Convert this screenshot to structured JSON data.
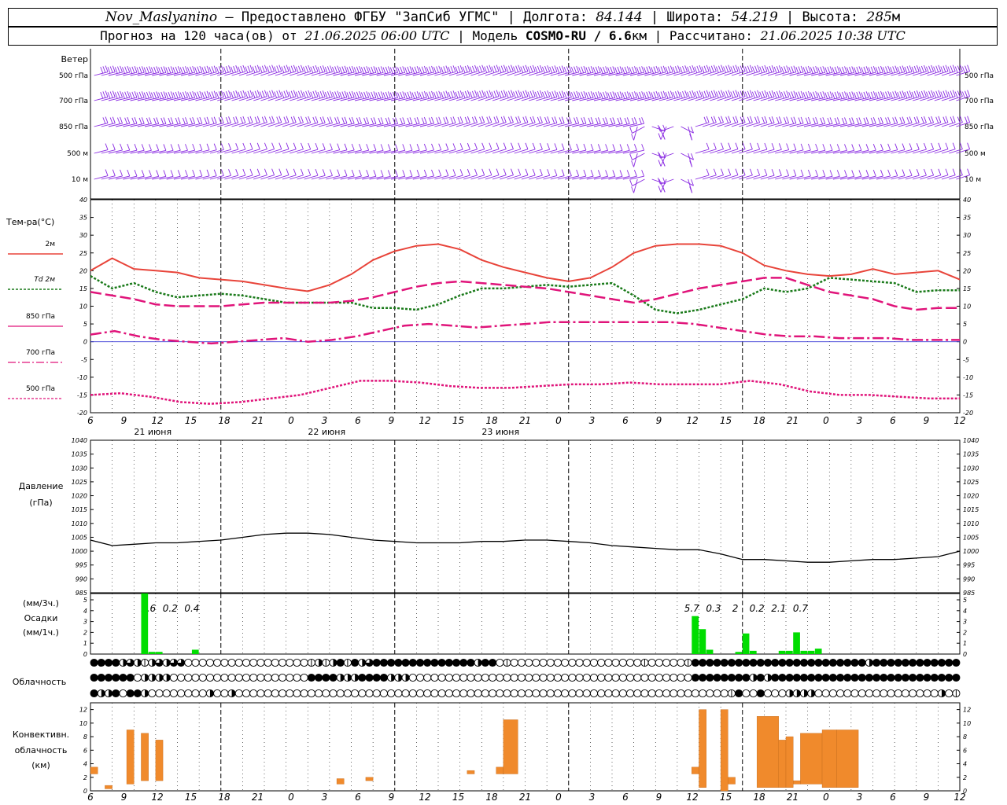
{
  "header": {
    "station": "Nov_Maslyanino",
    "provider": "— Предоставлено ФГБУ \"ЗапСиб УГМС\"",
    "lon_label": "Долгота:",
    "lon": "84.144",
    "lat_label": "Широта:",
    "lat": "54.219",
    "alt_label": "Высота:",
    "alt": "285",
    "alt_unit": "м",
    "forecast_label": "Прогноз на 120 часа(ов) от",
    "forecast_time": "21.06.2025 06:00 UTC",
    "model_label": "Модель",
    "model": "COSMO-RU / 6.6",
    "model_unit": "км",
    "calc_label": "Рассчитано:",
    "calc_time": "21.06.2025 10:38 UTC"
  },
  "colors": {
    "wind": "#8a2be2",
    "t2m": "#e8443a",
    "td2m": "#1a7a1a",
    "t850": "#e0147a",
    "t700": "#e0147a",
    "t500": "#e0147a",
    "zero_line": "#3b3bd6",
    "pressure": "#000000",
    "precip": "#00dd00",
    "convective": "#f08a2c"
  },
  "wind_panel": {
    "title": "Ветер",
    "levels": [
      "500 гПа",
      "700 гПа",
      "850 гПа",
      "500 м",
      "10 м"
    ]
  },
  "temp_panel": {
    "title": "Тем-ра(°С)",
    "legend": [
      "2м",
      "Td 2м",
      "850 гПа",
      "700 гПа",
      "500 гПа"
    ],
    "yticks": [
      40,
      35,
      30,
      25,
      20,
      15,
      10,
      5,
      0,
      -5,
      -10,
      -15,
      -20
    ]
  },
  "time_axis": {
    "hour_labels": [
      "6",
      "9",
      "12",
      "15",
      "18",
      "21",
      "0",
      "3",
      "6",
      "9",
      "12",
      "15",
      "18",
      "21",
      "0",
      "3",
      "6",
      "9",
      "12",
      "15",
      "18",
      "21",
      "0",
      "3",
      "6",
      "9",
      "12"
    ],
    "day_labels": [
      "21 июня",
      "22 июня",
      "23 июня"
    ]
  },
  "pressure_panel": {
    "title": "Давление",
    "unit": "(гПа)",
    "yticks": [
      1040,
      1035,
      1030,
      1025,
      1020,
      1015,
      1010,
      1005,
      1000,
      995,
      990,
      985
    ]
  },
  "precip_panel": {
    "unit3": "(мм/3ч.)",
    "title": "Осадки",
    "unit1": "(мм/1ч.)",
    "yticks": [
      5,
      4,
      3,
      2,
      1,
      0
    ],
    "sums": [
      {
        "h": 8,
        "text": "5.6"
      },
      {
        "h": 11,
        "text": "0.2"
      },
      {
        "h": 14,
        "text": "0.4"
      },
      {
        "h": 83,
        "text": "5.7"
      },
      {
        "h": 86,
        "text": "0.3"
      },
      {
        "h": 89,
        "text": "2"
      },
      {
        "h": 92,
        "text": "0.2"
      },
      {
        "h": 95,
        "text": "2.1"
      },
      {
        "h": 98,
        "text": "0.7"
      }
    ]
  },
  "cloud_panel": {
    "title": "Облачность"
  },
  "conv_panel": {
    "title1": "Конвективн.",
    "title2": "облачность",
    "unit": "(км)",
    "yticks": [
      12,
      10,
      8,
      6,
      4,
      2,
      0
    ]
  },
  "chart_data": [
    {
      "type": "line",
      "name": "temperature",
      "x_hours": [
        0,
        3,
        6,
        9,
        12,
        15,
        18,
        21,
        24,
        27,
        30,
        33,
        36,
        39,
        42,
        45,
        48,
        51,
        54,
        57,
        60,
        63,
        66,
        69,
        72,
        75,
        78,
        81,
        84,
        87,
        90,
        93,
        96,
        99,
        102,
        105
      ],
      "series": [
        {
          "name": "2м",
          "style": "solid",
          "values": [
            20,
            23.5,
            20.5,
            20,
            19.5,
            18,
            17.5,
            17,
            16,
            15,
            14.2,
            16,
            19,
            23,
            25.5,
            27,
            27.5,
            26,
            23,
            21,
            19.5,
            18,
            17,
            18,
            21,
            25,
            27,
            27.5,
            27.5,
            27,
            25,
            21.5,
            20,
            19,
            18.5,
            19,
            20.5,
            19,
            19.5,
            20,
            17.5
          ]
        },
        {
          "name": "Td 2м",
          "style": "dotted",
          "values": [
            18.5,
            15,
            16.5,
            14,
            12.5,
            13,
            13.5,
            13,
            12,
            11,
            11,
            11,
            11,
            9.5,
            9.5,
            9,
            10.5,
            13,
            15,
            15,
            15.5,
            16,
            15.5,
            16,
            16.5,
            13,
            9,
            8,
            9,
            10.5,
            12,
            15,
            14,
            15,
            18,
            17.5,
            17,
            16.5,
            14,
            14.5,
            14.5
          ]
        },
        {
          "name": "850 гПа",
          "style": "dash",
          "values": [
            14,
            13,
            12,
            10.5,
            10,
            10,
            10,
            10.5,
            11,
            11,
            11,
            11,
            11.5,
            12.5,
            14,
            15.5,
            16.5,
            17,
            16.5,
            16,
            15.5,
            15,
            14,
            13,
            12,
            11,
            12,
            13.5,
            15,
            16,
            17,
            18,
            18,
            16,
            14,
            13,
            12,
            10,
            9,
            9.5,
            9.5
          ]
        },
        {
          "name": "700 гПа",
          "style": "dashdot",
          "values": [
            2,
            3,
            1.5,
            0.5,
            0,
            -0.5,
            0,
            0.5,
            1,
            0,
            0.5,
            1.5,
            3,
            4.5,
            5,
            4.5,
            4,
            4.5,
            5,
            5.5,
            5.5,
            5.5,
            5.5,
            5.5,
            5.5,
            5,
            4,
            3,
            2,
            1.5,
            1.5,
            1,
            1,
            1,
            0.5,
            0.5,
            0.5
          ]
        },
        {
          "name": "500 гПа",
          "style": "dotted",
          "values": [
            -15,
            -14.5,
            -15.5,
            -17,
            -17.5,
            -17,
            -16,
            -15,
            -13,
            -11,
            -11,
            -11.5,
            -12.5,
            -13,
            -13,
            -12.5,
            -12,
            -12,
            -11.5,
            -12,
            -12,
            -12,
            -11,
            -12,
            -14,
            -15,
            -15,
            -15.5,
            -16,
            -16
          ]
        }
      ],
      "ylim": [
        -20,
        40
      ]
    },
    {
      "type": "line",
      "name": "pressure",
      "x_hours": [
        0,
        3,
        6,
        9,
        12,
        15,
        18,
        21,
        24,
        27,
        30,
        33,
        36,
        39,
        42,
        45,
        48,
        51,
        54,
        57,
        60,
        63,
        66,
        69,
        72,
        75,
        78,
        81,
        84,
        87,
        90,
        93,
        96,
        99,
        102,
        105,
        108,
        111,
        114,
        117,
        120
      ],
      "values": [
        1004,
        1002,
        1002.5,
        1003,
        1003,
        1003.5,
        1004,
        1005,
        1006,
        1006.5,
        1006.5,
        1006,
        1005,
        1004,
        1003.5,
        1003,
        1003,
        1003,
        1003.5,
        1003.5,
        1004,
        1004,
        1003.5,
        1003,
        1002,
        1001.5,
        1001,
        1000.5,
        1000.5,
        999,
        997,
        997,
        996.5,
        996,
        996,
        996.5,
        997,
        997,
        997.5,
        998,
        1000
      ],
      "ylim": [
        985,
        1040
      ]
    },
    {
      "type": "bar",
      "name": "precipitation",
      "bars": [
        {
          "h": 7,
          "v": 5.6
        },
        {
          "h": 8,
          "v": 0.2
        },
        {
          "h": 9,
          "v": 0.2
        },
        {
          "h": 14,
          "v": 0.4
        },
        {
          "h": 83,
          "v": 3.5
        },
        {
          "h": 84,
          "v": 2.3
        },
        {
          "h": 85,
          "v": 0.4
        },
        {
          "h": 89,
          "v": 0.2
        },
        {
          "h": 90,
          "v": 1.9
        },
        {
          "h": 91,
          "v": 0.3
        },
        {
          "h": 95,
          "v": 0.3
        },
        {
          "h": 96,
          "v": 0.3
        },
        {
          "h": 97,
          "v": 2
        },
        {
          "h": 98,
          "v": 0.3
        },
        {
          "h": 99,
          "v": 0.3
        },
        {
          "h": 100,
          "v": 0.5
        }
      ],
      "ylim": [
        0,
        5
      ]
    },
    {
      "type": "bar",
      "name": "convective",
      "bars": [
        {
          "h0": 0,
          "h1": 1,
          "lo": 2.5,
          "hi": 3.5
        },
        {
          "h0": 2,
          "h1": 3,
          "lo": 0.3,
          "hi": 0.8
        },
        {
          "h0": 5,
          "h1": 6,
          "lo": 1,
          "hi": 9
        },
        {
          "h0": 7,
          "h1": 8,
          "lo": 1.5,
          "hi": 8.5
        },
        {
          "h0": 9,
          "h1": 10,
          "lo": 1.5,
          "hi": 7.5
        },
        {
          "h0": 34,
          "h1": 35,
          "lo": 1,
          "hi": 1.8
        },
        {
          "h0": 38,
          "h1": 39,
          "lo": 1.5,
          "hi": 2
        },
        {
          "h0": 52,
          "h1": 53,
          "lo": 2.5,
          "hi": 3
        },
        {
          "h0": 56,
          "h1": 57,
          "lo": 2.5,
          "hi": 3.5
        },
        {
          "h0": 57,
          "h1": 59,
          "lo": 2.5,
          "hi": 10.5
        },
        {
          "h0": 83,
          "h1": 84,
          "lo": 2.5,
          "hi": 3.5
        },
        {
          "h0": 84,
          "h1": 85,
          "lo": 0.5,
          "hi": 12
        },
        {
          "h0": 87,
          "h1": 88,
          "lo": 0,
          "hi": 12
        },
        {
          "h0": 88,
          "h1": 89,
          "lo": 1,
          "hi": 2
        },
        {
          "h0": 92,
          "h1": 95,
          "lo": 0.5,
          "hi": 11
        },
        {
          "h0": 95,
          "h1": 96,
          "lo": 0.5,
          "hi": 7.5
        },
        {
          "h0": 96,
          "h1": 97,
          "lo": 0.5,
          "hi": 8
        },
        {
          "h0": 97,
          "h1": 98,
          "lo": 1,
          "hi": 1.5
        },
        {
          "h0": 98,
          "h1": 101,
          "lo": 1,
          "hi": 8.5
        },
        {
          "h0": 101,
          "h1": 103,
          "lo": 0.5,
          "hi": 9
        },
        {
          "h0": 103,
          "h1": 106,
          "lo": 0.5,
          "hi": 9
        }
      ],
      "ylim": [
        0,
        13
      ]
    },
    {
      "type": "table",
      "name": "cloudiness",
      "rows": [
        [
          4,
          4,
          4,
          4,
          2,
          3,
          2,
          1,
          2,
          3,
          2,
          3,
          3,
          0,
          0,
          0,
          0,
          0,
          0,
          0,
          0,
          0,
          0,
          0,
          0,
          0,
          0,
          0,
          0,
          0,
          1,
          2,
          1,
          2,
          4,
          1,
          4,
          2,
          3,
          4,
          4,
          4,
          4,
          4,
          4,
          4,
          4,
          4,
          4,
          4,
          4,
          4,
          4,
          2,
          4,
          4,
          0,
          1,
          0,
          0,
          0,
          0,
          0,
          0,
          0,
          0,
          0,
          0,
          0,
          0,
          0,
          0,
          0,
          0,
          0,
          0,
          1,
          0,
          0,
          0,
          0,
          0,
          1,
          4,
          4,
          4,
          4,
          4,
          4,
          4,
          4,
          4,
          4,
          4,
          4,
          4,
          4,
          4,
          4,
          4,
          4,
          4,
          4,
          4,
          4,
          4,
          4,
          2,
          4,
          4,
          4,
          4,
          4,
          4,
          4,
          4,
          4,
          4,
          4,
          4
        ],
        [
          4,
          4,
          4,
          4,
          4,
          4,
          0,
          2,
          2,
          2,
          2,
          0,
          0,
          0,
          0,
          0,
          0,
          0,
          0,
          0,
          0,
          0,
          0,
          0,
          0,
          0,
          0,
          0,
          0,
          0,
          4,
          4,
          4,
          4,
          2,
          2,
          2,
          4,
          4,
          4,
          4,
          2,
          2,
          2,
          0,
          0,
          0,
          0,
          0,
          0,
          0,
          0,
          0,
          0,
          0,
          0,
          0,
          0,
          0,
          0,
          0,
          0,
          0,
          0,
          0,
          0,
          0,
          0,
          0,
          0,
          0,
          0,
          0,
          0,
          0,
          0,
          0,
          0,
          0,
          0,
          0,
          0,
          0,
          4,
          4,
          4,
          4,
          4,
          4,
          4,
          4,
          2,
          4,
          2,
          4,
          4,
          4,
          4,
          4,
          4,
          4,
          4,
          4,
          4,
          4,
          4,
          4,
          4,
          4,
          4,
          4,
          4,
          4,
          4,
          4,
          4,
          4,
          4,
          4,
          4
        ],
        [
          4,
          2,
          2,
          4,
          0,
          4,
          4,
          2,
          0,
          0,
          0,
          0,
          0,
          0,
          0,
          0,
          2,
          0,
          0,
          2,
          0,
          0,
          0,
          0,
          0,
          0,
          0,
          0,
          0,
          0,
          0,
          0,
          0,
          0,
          0,
          0,
          0,
          0,
          0,
          0,
          0,
          0,
          0,
          0,
          0,
          0,
          0,
          0,
          0,
          0,
          0,
          0,
          0,
          0,
          0,
          0,
          0,
          0,
          0,
          0,
          0,
          0,
          0,
          0,
          0,
          0,
          0,
          0,
          0,
          0,
          0,
          0,
          0,
          0,
          0,
          0,
          0,
          0,
          0,
          0,
          0,
          0,
          0,
          0,
          0,
          0,
          0,
          0,
          1,
          4,
          0,
          0,
          4,
          0,
          0,
          0,
          2,
          2,
          2,
          2,
          0,
          0,
          0,
          0,
          0,
          0,
          0,
          0,
          0,
          0,
          0,
          0,
          0,
          0,
          0,
          0,
          0,
          2,
          0,
          1
        ]
      ]
    }
  ]
}
